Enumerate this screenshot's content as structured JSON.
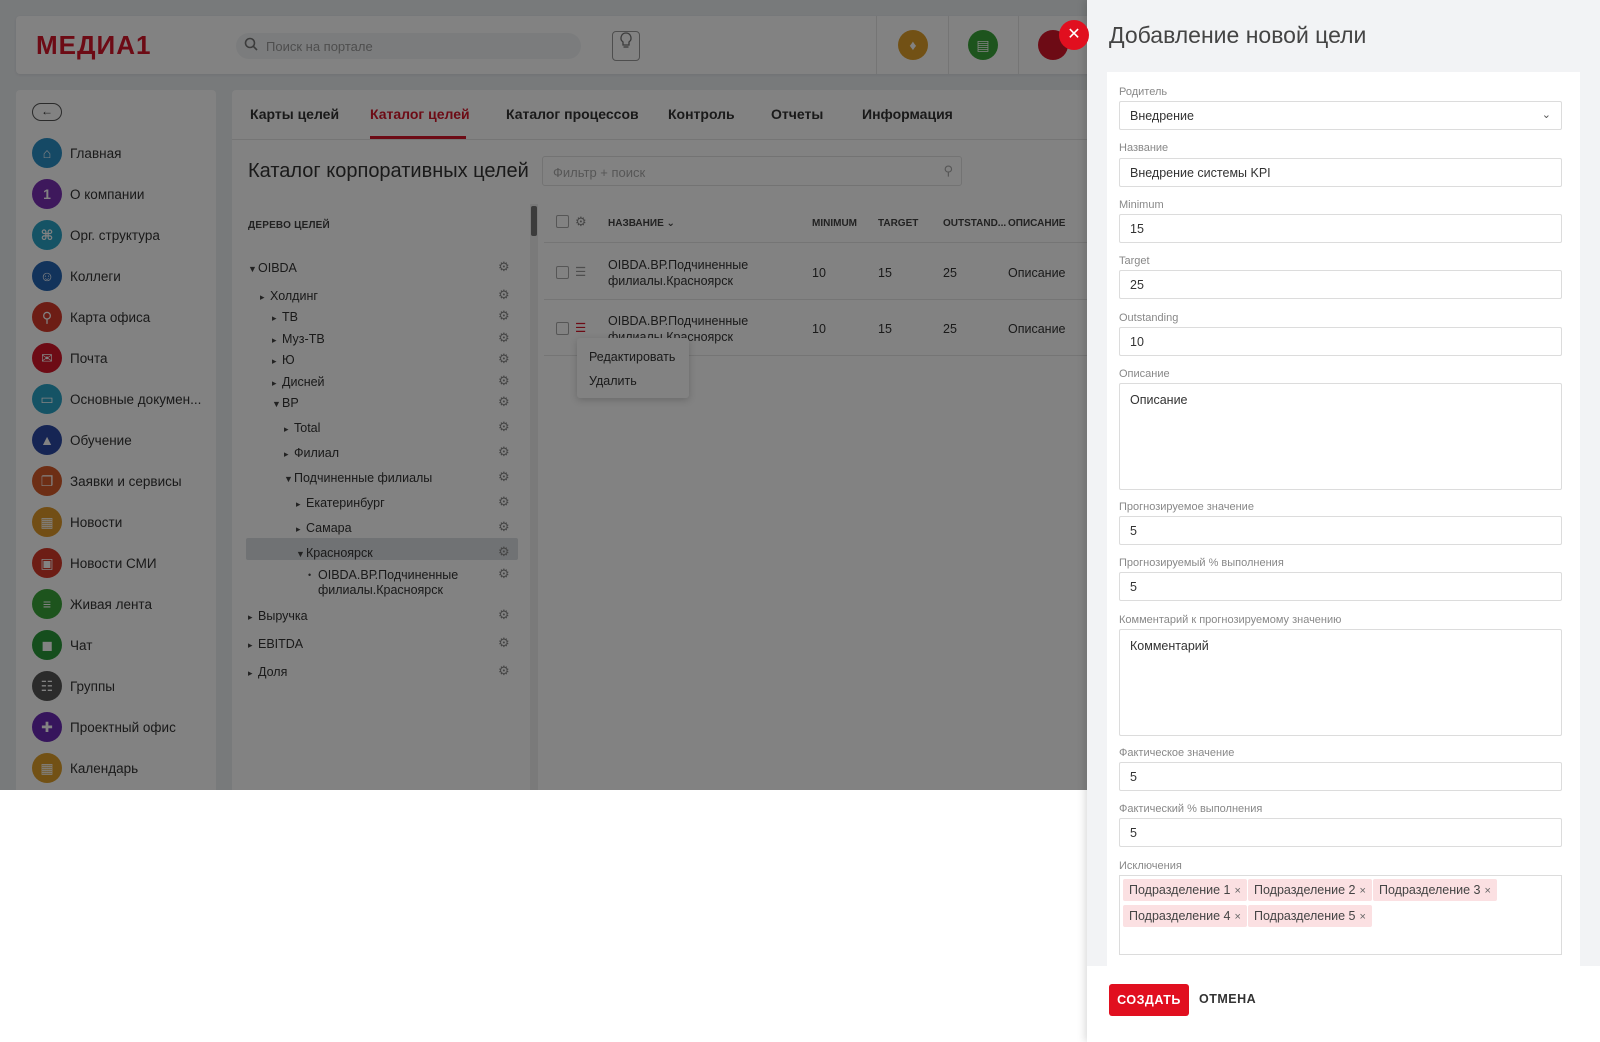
{
  "header": {
    "logo": "МЕДИА1",
    "search_placeholder": "Поиск на портале"
  },
  "sidebar": {
    "items": [
      {
        "label": "Главная",
        "icon": "home-icon",
        "color": "#2a8fc7"
      },
      {
        "label": "О компании",
        "icon": "number-one-icon",
        "glyph": "1",
        "color": "#7b2fb5"
      },
      {
        "label": "Орг. структура",
        "icon": "org-structure-icon",
        "color": "#2aa3c7"
      },
      {
        "label": "Коллеги",
        "icon": "colleagues-icon",
        "color": "#2464b3"
      },
      {
        "label": "Карта офиса",
        "icon": "map-pin-icon",
        "color": "#d63a2a"
      },
      {
        "label": "Почта",
        "icon": "mail-icon",
        "color": "#d6162a"
      },
      {
        "label": "Основные докумен...",
        "icon": "documents-icon",
        "color": "#2aa3c7"
      },
      {
        "label": "Обучение",
        "icon": "graduation-cap-icon",
        "color": "#2b4aa5"
      },
      {
        "label": "Заявки и сервисы",
        "icon": "services-icon",
        "color": "#d65a2a"
      },
      {
        "label": "Новости",
        "icon": "news-icon",
        "color": "#e09a2a"
      },
      {
        "label": "Новости СМИ",
        "icon": "media-news-icon",
        "color": "#d63a2a"
      },
      {
        "label": "Живая лента",
        "icon": "feed-icon",
        "color": "#3aa63a"
      },
      {
        "label": "Чат",
        "icon": "chat-icon",
        "color": "#2a9a3a"
      },
      {
        "label": "Группы",
        "icon": "groups-icon",
        "color": "#555555"
      },
      {
        "label": "Проектный офис",
        "icon": "project-office-icon",
        "color": "#6a2ab5"
      },
      {
        "label": "Календарь",
        "icon": "calendar-icon",
        "color": "#e0a02a"
      }
    ]
  },
  "tabs": [
    "Карты целей",
    "Каталог целей",
    "Каталог процессов",
    "Контроль",
    "Отчеты",
    "Информация"
  ],
  "active_tab": "Каталог целей",
  "page_title": "Каталог корпоративных целей",
  "filter_placeholder": "Фильтр + поиск",
  "tree": {
    "header": "ДЕРЕВО ЦЕЛЕЙ",
    "nodes": [
      {
        "label": "OIBDA"
      },
      {
        "label": "Холдинг"
      },
      {
        "label": "ТВ"
      },
      {
        "label": "Муз-ТВ"
      },
      {
        "label": "Ю"
      },
      {
        "label": "Дисней"
      },
      {
        "label": "ВР"
      },
      {
        "label": "Total"
      },
      {
        "label": "Филиал"
      },
      {
        "label": "Подчиненные филиалы"
      },
      {
        "label": "Екатеринбург"
      },
      {
        "label": "Самара"
      },
      {
        "label": "Красноярск"
      },
      {
        "label": "OIBDA.ВР.Подчиненные филиалы.Красноярск"
      },
      {
        "label": "Выручка"
      },
      {
        "label": "EBITDA"
      },
      {
        "label": "Доля"
      }
    ]
  },
  "grid": {
    "columns": [
      "НАЗВАНИЕ",
      "MINIMUM",
      "TARGET",
      "OUTSTAND...",
      "ОПИСАНИЕ"
    ],
    "rows": [
      {
        "name": "OIBDA.ВР.Подчиненные филиалы.Красноярск",
        "minimum": "10",
        "target": "15",
        "outstanding": "25",
        "description": "Описание"
      },
      {
        "name": "OIBDA.ВР.Подчиненные филиалы.Красноярск",
        "minimum": "10",
        "target": "15",
        "outstanding": "25",
        "description": "Описание"
      }
    ]
  },
  "context_menu": {
    "edit": "Редактировать",
    "delete": "Удалить"
  },
  "modal": {
    "title": "Добавление новой цели",
    "fields": {
      "parent": {
        "label": "Родитель",
        "value": "Внедрение"
      },
      "name": {
        "label": "Название",
        "value": "Внедрение системы KPI"
      },
      "minimum": {
        "label": "Minimum",
        "value": "15"
      },
      "target": {
        "label": "Target",
        "value": "25"
      },
      "outstanding": {
        "label": "Outstanding",
        "value": "10"
      },
      "description": {
        "label": "Описание",
        "value": "Описание"
      },
      "forecast_value": {
        "label": "Прогнозируемое значение",
        "value": "5"
      },
      "forecast_percent": {
        "label": "Прогнозируемый % выполнения",
        "value": "5"
      },
      "forecast_comment": {
        "label": "Комментарий к прогнозируемому значению",
        "value": "Комментарий"
      },
      "actual_value": {
        "label": "Фактическое значение",
        "value": "5"
      },
      "actual_percent": {
        "label": "Фактический % выполнения",
        "value": "5"
      },
      "exclusions": {
        "label": "Исключения",
        "tags": [
          "Подразделение 1",
          "Подразделение 2",
          "Подразделение 3",
          "Подразделение 4",
          "Подразделение 5"
        ]
      }
    },
    "create_label": "СОЗДАТЬ",
    "cancel_label": "ОТМЕНА"
  },
  "colors": {
    "accent": "#e10f1f",
    "brand": "#d6162a",
    "overlay": "rgba(0,0,0,0.49)"
  }
}
